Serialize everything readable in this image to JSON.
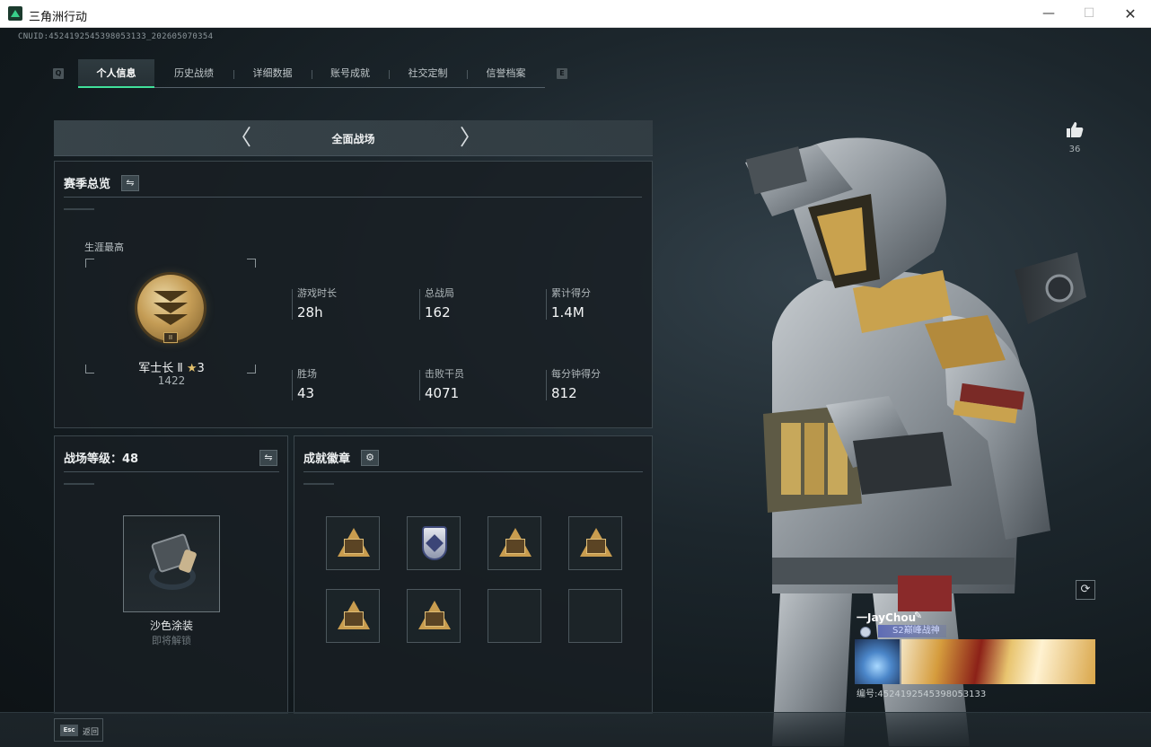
{
  "window": {
    "title": "三角洲行动",
    "minimize_glyph": "—",
    "maximize_glyph": "☐",
    "close_glyph": "✕"
  },
  "header": {
    "cnuid": "CNUID:4524192545398053133_202605070354"
  },
  "tabs": {
    "edge_left": "Q",
    "edge_right": "E",
    "items": [
      {
        "label": "个人信息",
        "active": true
      },
      {
        "label": "历史战绩",
        "active": false
      },
      {
        "label": "详细数据",
        "active": false
      },
      {
        "label": "账号成就",
        "active": false
      },
      {
        "label": "社交定制",
        "active": false
      },
      {
        "label": "信誉档案",
        "active": false
      }
    ]
  },
  "mode": {
    "title": "全面战场",
    "prev_glyph": "〈",
    "next_glyph": "〉"
  },
  "season": {
    "title": "赛季总览",
    "swap_glyph": "⇋",
    "career_label": "生涯最高",
    "rank_name": "军士长 Ⅱ",
    "rank_stars": "3",
    "star_glyph": "★",
    "rank_score": "1422",
    "rank_tag": "II",
    "stats": [
      {
        "label": "游戏时长",
        "value": "28h"
      },
      {
        "label": "总战局",
        "value": "162"
      },
      {
        "label": "累计得分",
        "value": "1.4M"
      },
      {
        "label": "胜场",
        "value": "43"
      },
      {
        "label": "击败干员",
        "value": "4071"
      },
      {
        "label": "每分钟得分",
        "value": "812"
      }
    ]
  },
  "level": {
    "title": "战场等级：48",
    "swap_glyph": "⇋",
    "item_name": "沙色涂装",
    "item_status": "即将解锁"
  },
  "achievements": {
    "title": "成就徽章",
    "settings_glyph": "⚙",
    "badges": [
      {
        "icon": "gold-triangle-badge-icon"
      },
      {
        "icon": "blue-shield-badge-icon"
      },
      {
        "icon": "gold-triangle-badge-icon"
      },
      {
        "icon": "gold-triangle-badge-icon"
      },
      {
        "icon": "gold-triangle-badge-icon"
      },
      {
        "icon": "gold-triangle-badge-icon"
      },
      {
        "icon": "empty-badge-slot"
      },
      {
        "icon": "empty-badge-slot"
      }
    ]
  },
  "profile": {
    "likes": "36",
    "refresh_glyph": "⟳",
    "player_name": "一JayChou",
    "edit_glyph": "✎",
    "player_title": "S2巅峰战神",
    "player_id": "编号:4524192545398053133"
  },
  "footer": {
    "esc_key": "Esc",
    "esc_label": "返回"
  },
  "colors": {
    "accent": "#41e09a",
    "gold": "#c99d4f",
    "panel": "#181f23"
  }
}
